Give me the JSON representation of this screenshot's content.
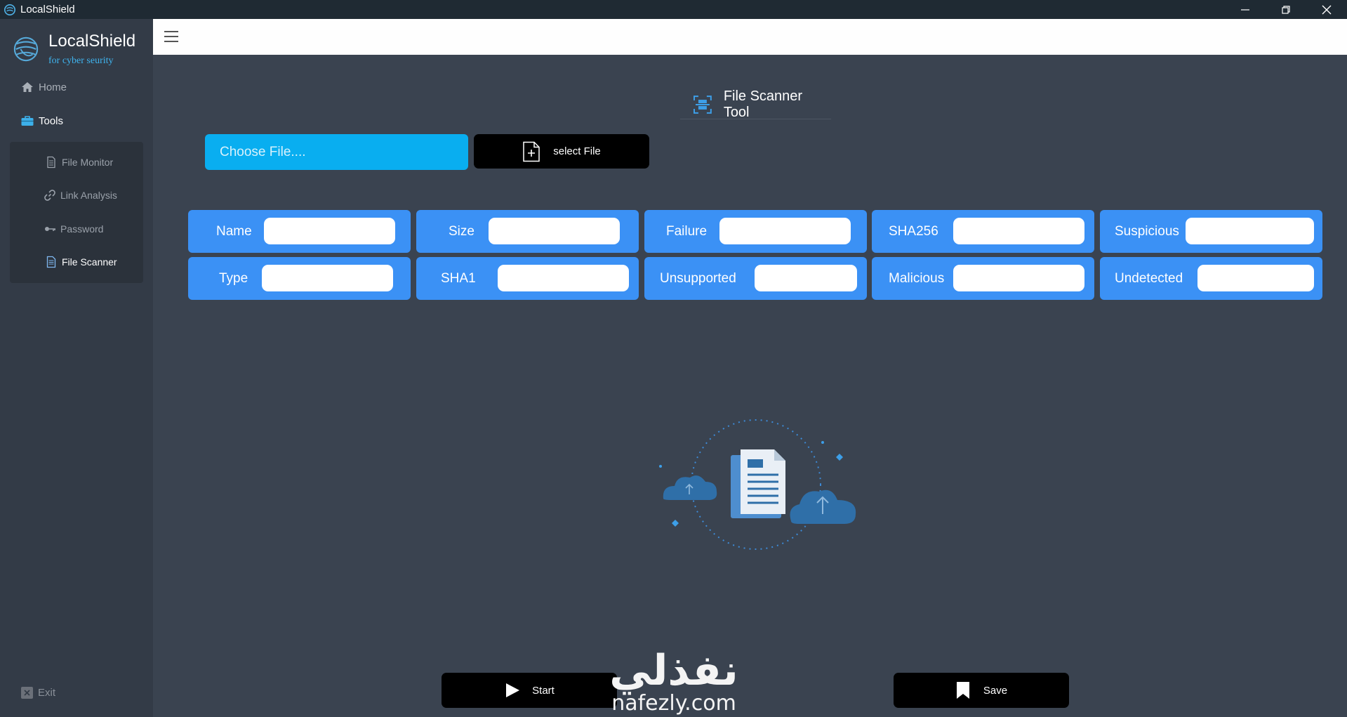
{
  "window": {
    "title": "LocalShield"
  },
  "sidebar": {
    "brand_name": "LocalShield",
    "tagline": "for cyber seurity",
    "home_label": "Home",
    "tools_label": "Tools",
    "sub_items": [
      {
        "label": "File Monitor",
        "icon": "document-icon"
      },
      {
        "label": "Link Analysis",
        "icon": "link-icon"
      },
      {
        "label": "Password",
        "icon": "key-icon"
      },
      {
        "label": "File Scanner",
        "icon": "file-text-icon"
      }
    ],
    "exit_label": "Exit"
  },
  "main": {
    "tool_title": "File Scanner Tool",
    "choose_file_placeholder": "Choose File....",
    "select_file_label": "select File",
    "fields": [
      {
        "label": "Name",
        "value": ""
      },
      {
        "label": "Size",
        "value": ""
      },
      {
        "label": "Failure",
        "value": ""
      },
      {
        "label": "SHA256",
        "value": ""
      },
      {
        "label": "Suspicious",
        "value": ""
      },
      {
        "label": "Type",
        "value": ""
      },
      {
        "label": "SHA1",
        "value": ""
      },
      {
        "label": "Unsupported",
        "value": ""
      },
      {
        "label": "Malicious",
        "value": ""
      },
      {
        "label": "Undetected",
        "value": ""
      }
    ],
    "start_label": "Start",
    "save_label": "Save"
  },
  "watermark": {
    "arabic": "نفذلي",
    "latin": "nafezly.com"
  },
  "colors": {
    "accent_blue": "#3b91f5",
    "input_cyan": "#09aef0",
    "background": "#3a4350",
    "sidebar": "#333b47",
    "titlebar": "#1f2a33"
  }
}
